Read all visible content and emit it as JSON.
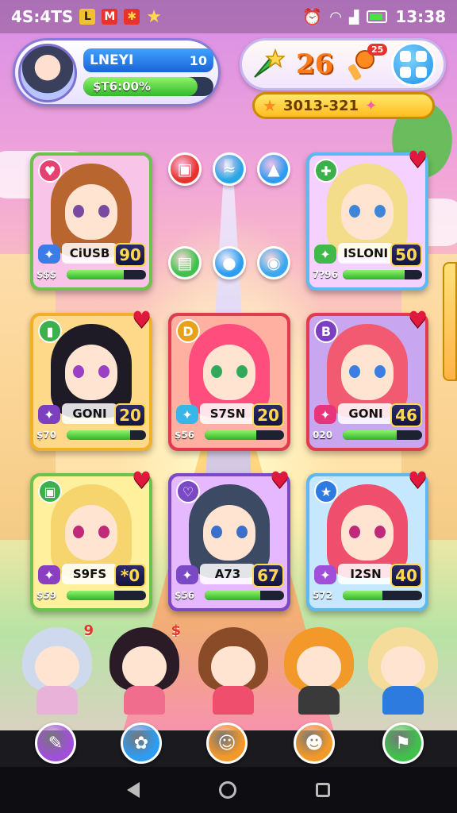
{
  "status": {
    "left_text": "4S:4TS",
    "time": "13:38",
    "icons": [
      "notification-l-icon",
      "notification-app-icon",
      "notification-game-icon",
      "star-icon"
    ]
  },
  "profile": {
    "name": "LNEYI",
    "level": "10",
    "xp_text": "$T6:00%",
    "xp_fraction": 0.88
  },
  "resources": {
    "item1_icon": "rocket-star-icon",
    "count": "26",
    "item2_icon": "torch-gem-icon",
    "item2_badge": "25",
    "gold_text": "3013-321"
  },
  "middle_buttons": [
    {
      "name": "red-chest-button",
      "color": "#e8322b",
      "glyph": "▣"
    },
    {
      "name": "blue-swirl-button",
      "color": "#27a7e6",
      "glyph": "≈"
    },
    {
      "name": "up-arrow-button",
      "color": "#2e9cf0",
      "glyph": "▲"
    },
    {
      "name": "green-book-button",
      "color": "#3fc14b",
      "glyph": "▤"
    },
    {
      "name": "water-drop-button",
      "color": "#2b9ef0",
      "glyph": "●"
    },
    {
      "name": "orb-button",
      "color": "#3aa7ee",
      "glyph": "◉"
    }
  ],
  "cards": [
    {
      "name": "CiUSB",
      "power": "90",
      "cost": "$$$",
      "hp": 0.72,
      "frame": "#6cc24a",
      "bg": "#f8c5e9",
      "hair": "#b9652f",
      "eye": "#7a4aa0",
      "badge_color": "#e54272",
      "badge_glyph": "♥",
      "weapon_color": "#3b7ce6",
      "heart": false
    },
    {
      "name": "ISLONI",
      "power": "50",
      "cost": "7?96",
      "hp": 0.78,
      "frame": "#5fb8ef",
      "bg": "#f4d1ff",
      "hair": "#f3dc8a",
      "eye": "#3f86d9",
      "badge_color": "#3cb04a",
      "badge_glyph": "✚",
      "weapon_color": "#40b84a",
      "heart": true
    },
    {
      "name": "GONI",
      "power": "20",
      "cost": "$70",
      "hp": 0.8,
      "frame": "#f2b02a",
      "bg": "#ffd98a",
      "hair": "#1e1a26",
      "eye": "#9c3fc7",
      "badge_color": "#3cb04a",
      "badge_glyph": "▮",
      "weapon_color": "#7c3fc0",
      "heart": true
    },
    {
      "name": "S7SN",
      "power": "20",
      "cost": "$56",
      "hp": 0.65,
      "frame": "#e23a4e",
      "bg": "#ffb0a0",
      "hair": "#ff4d7d",
      "eye": "#2faa5a",
      "badge_color": "#e8a21a",
      "badge_glyph": "D",
      "weapon_color": "#39b6e8",
      "heart": false
    },
    {
      "name": "GONI",
      "power": "46",
      "cost": "020",
      "hp": 0.68,
      "frame": "#e23a4e",
      "bg": "#c9a6f0",
      "hair": "#f25a72",
      "eye": "#3a7fe0",
      "badge_color": "#7c3fc0",
      "badge_glyph": "B",
      "weapon_color": "#e8347a",
      "heart": true
    },
    {
      "name": "S9FS",
      "power": "*0",
      "cost": "$59",
      "hp": 0.6,
      "frame": "#6cc24a",
      "bg": "#fff09e",
      "hair": "#f6d56e",
      "eye": "#c0287a",
      "badge_color": "#3cb04a",
      "badge_glyph": "▣",
      "weapon_color": "#8a3fc0",
      "heart": true
    },
    {
      "name": "A73",
      "power": "67",
      "cost": "$56",
      "hp": 0.7,
      "frame": "#7b48c6",
      "bg": "#e6b8ff",
      "hair": "#3d4a63",
      "eye": "#3c6fc9",
      "badge_color": "#7b48c6",
      "badge_glyph": "♡",
      "weapon_color": "#7b48c6",
      "heart": true
    },
    {
      "name": "I2SN",
      "power": "40",
      "cost": "572",
      "hp": 0.5,
      "frame": "#5fb8ef",
      "bg": "#c6e8ff",
      "hair": "#f04e6d",
      "eye": "#c0287a",
      "badge_color": "#2e7be0",
      "badge_glyph": "★",
      "weapon_color": "#a050d8",
      "heart": true
    }
  ],
  "roster": [
    {
      "name": "chibi-silver",
      "hair": "#cfd9ee",
      "body": "#e9b2d8",
      "badge": "9"
    },
    {
      "name": "chibi-dark-bun",
      "hair": "#2a1b26",
      "body": "#f06d8e",
      "badge": "$"
    },
    {
      "name": "chibi-brown-braids",
      "hair": "#8a4b28",
      "body": "#f04e6d",
      "badge": ""
    },
    {
      "name": "chibi-orange-spiky",
      "hair": "#f2992a",
      "body": "#3a3a3a",
      "badge": ""
    },
    {
      "name": "chibi-blonde-pink",
      "hair": "#f6dc9a",
      "body": "#2e7be0",
      "badge": ""
    }
  ],
  "hud_buttons": [
    {
      "name": "wand-button",
      "color": "#a050d8",
      "glyph": "✎"
    },
    {
      "name": "paw-button",
      "color": "#2e9cf0",
      "glyph": "✿"
    },
    {
      "name": "hero-face-button",
      "color": "#f2992a",
      "glyph": "☺"
    },
    {
      "name": "ally-face-button",
      "color": "#f2992a",
      "glyph": "☻"
    },
    {
      "name": "shield-tool-button",
      "color": "#3fc14b",
      "glyph": "⚑"
    }
  ]
}
